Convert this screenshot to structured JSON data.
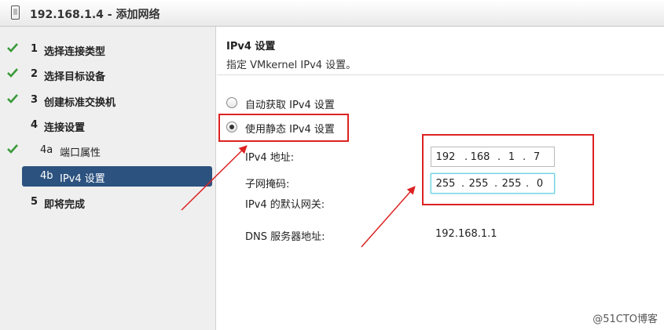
{
  "window": {
    "title": "192.168.1.4 - 添加网络"
  },
  "steps": [
    {
      "num": "1",
      "label": "选择连接类型",
      "done": true
    },
    {
      "num": "2",
      "label": "选择目标设备",
      "done": true
    },
    {
      "num": "3",
      "label": "创建标准交换机",
      "done": true
    },
    {
      "num": "4",
      "label": "连接设置",
      "done": false
    },
    {
      "num": "4a",
      "label": "端口属性",
      "done": true
    },
    {
      "num": "4b",
      "label": "IPv4 设置",
      "done": false,
      "active": true
    },
    {
      "num": "5",
      "label": "即将完成",
      "done": false
    }
  ],
  "content": {
    "title": "IPv4 设置",
    "subtitle": "指定 VMkernel IPv4 设置。",
    "radio_auto": "自动获取 IPv4 设置",
    "radio_static": "使用静态 IPv4 设置",
    "ipv4_label": "IPv4 地址:",
    "ipv4_octets": [
      "192",
      "168",
      "1",
      "7"
    ],
    "mask_label": "子网掩码:",
    "mask_octets": [
      "255",
      "255",
      "255",
      "0"
    ],
    "gateway_label": "IPv4 的默认网关:",
    "dns_label": "DNS 服务器地址:",
    "dns_value": "192.168.1.1"
  },
  "watermark": "@51CTO博客",
  "colors": {
    "check": "#3a9a3a",
    "active_bg": "#2c527f",
    "annotation": "#dd2222",
    "focus": "#6ad0e0"
  }
}
